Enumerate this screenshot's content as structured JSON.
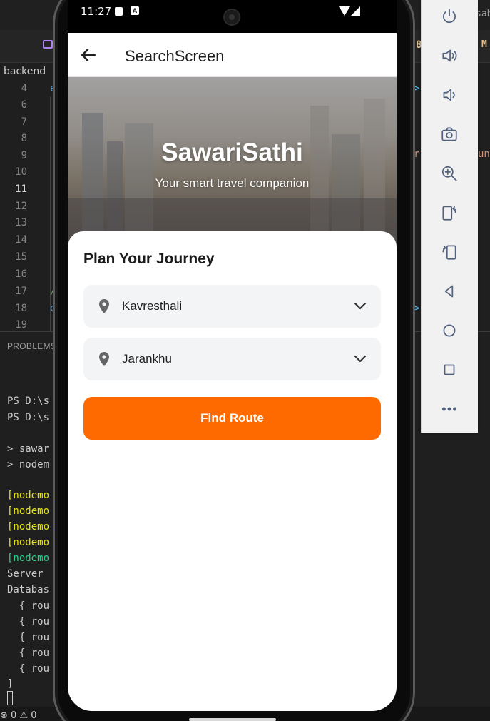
{
  "editor": {
    "breadcrumb": "backend",
    "line_numbers": [
      "4",
      "6",
      "7",
      "8",
      "9",
      "10",
      "11",
      "12",
      "13",
      "14",
      "15",
      "16",
      "17",
      "18",
      "19"
    ],
    "current_line": "11",
    "panel_tab": "PROBLEMS",
    "terminal_lines": [
      {
        "text": "PS D:\\s",
        "style": "plain"
      },
      {
        "text": "PS D:\\s",
        "style": "plain"
      },
      {
        "text": "> sawar",
        "style": "plain"
      },
      {
        "text": "> nodem",
        "style": "plain"
      },
      {
        "text": "[nodemo",
        "style": "y"
      },
      {
        "text": "[nodemo",
        "style": "y"
      },
      {
        "text": "[nodemo",
        "style": "y"
      },
      {
        "text": "[nodemo",
        "style": "y"
      },
      {
        "text": "[nodemo",
        "style": "g"
      },
      {
        "text": "Server",
        "style": "plain"
      },
      {
        "text": "Databas",
        "style": "plain"
      },
      {
        "text": "  { rou",
        "style": "plain"
      },
      {
        "text": "  { rou",
        "style": "plain"
      },
      {
        "text": "  { rou",
        "style": "plain"
      },
      {
        "text": "  { rou",
        "style": "plain"
      },
      {
        "text": "  { rou",
        "style": "plain"
      },
      {
        "text": "]",
        "style": "plain"
      }
    ],
    "status_errors": "⊗ 0 ⚠ 0",
    "right_fragments": {
      "tab_m": "M",
      "sab": "sab",
      "un": "un"
    }
  },
  "emulator_toolbar": {
    "buttons": [
      "power-icon",
      "volume-up-icon",
      "volume-down-icon",
      "camera-icon",
      "zoom-in-icon",
      "rotate-left-icon",
      "rotate-right-icon",
      "back-icon",
      "home-icon",
      "overview-icon",
      "more-icon"
    ]
  },
  "phone": {
    "status_bar": {
      "time": "11:27",
      "badge": "A"
    },
    "app_bar": {
      "title": "SearchScreen"
    },
    "hero": {
      "title": "SawariSathi",
      "subtitle": "Your smart travel companion"
    },
    "card": {
      "title": "Plan Your Journey",
      "from": "Kavresthali",
      "to": "Jarankhu",
      "button": "Find Route"
    },
    "colors": {
      "accent": "#ff6a00",
      "field_bg": "#f3f4f6"
    }
  }
}
